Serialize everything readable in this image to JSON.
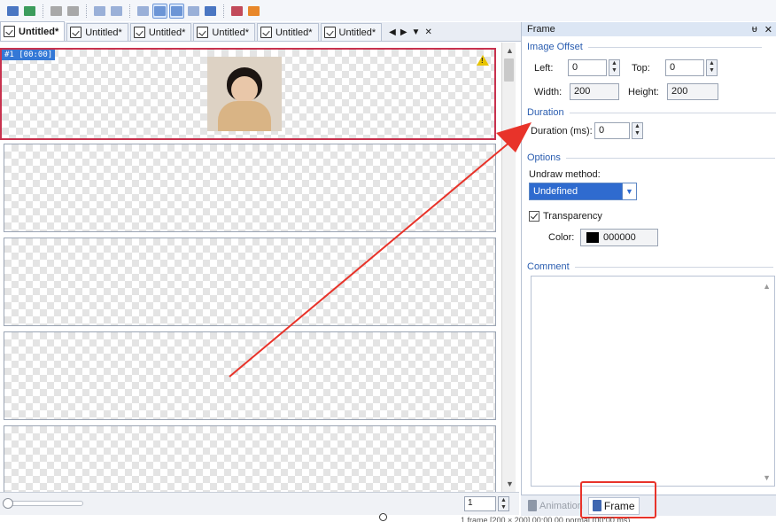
{
  "toolbar": {
    "buttons": [
      {
        "icon": "open-icon",
        "color": "#4a76c2"
      },
      {
        "icon": "save-icon",
        "color": "#3c9c5c"
      },
      {
        "icon": "copy-icon",
        "color": "#a8a8a8"
      },
      {
        "icon": "paste-icon",
        "color": "#a8a8a8"
      },
      {
        "icon": "flip-icon",
        "color": "#9ab0d8"
      },
      {
        "icon": "rotate-icon",
        "color": "#9ab0d8"
      },
      {
        "icon": "frame-view-icon",
        "color": "#9ab0d8"
      },
      {
        "icon": "thumbnail-view-icon",
        "color": "#6c95d6",
        "active": true
      },
      {
        "icon": "list-view-icon",
        "color": "#6c95d6",
        "active": true
      },
      {
        "icon": "grid-view-icon",
        "color": "#9ab0d8"
      },
      {
        "icon": "effects-icon",
        "color": "#4a76c2"
      },
      {
        "icon": "export-icon",
        "color": "#c24a5a"
      },
      {
        "icon": "rss-icon",
        "color": "#e8872a"
      }
    ]
  },
  "doc_tabs": {
    "tabs": [
      {
        "label": "Untitled*",
        "active": true
      },
      {
        "label": "Untitled*"
      },
      {
        "label": "Untitled*"
      },
      {
        "label": "Untitled*"
      },
      {
        "label": "Untitled*"
      },
      {
        "label": "Untitled*"
      }
    ],
    "nav": {
      "prev": "◀",
      "next": "▶",
      "menu": "▼",
      "close": "✕"
    }
  },
  "frames": {
    "first_label": "#1 [00:00]"
  },
  "bottom": {
    "page_value": "1",
    "status_text": "1 frame   [200 × 200]   00:00.00   normal   (00:00 ms)"
  },
  "panel": {
    "title": "Frame",
    "pin": "📌",
    "close": "✕",
    "image_offset": {
      "heading": "Image Offset",
      "left_label": "Left:",
      "left_value": "0",
      "top_label": "Top:",
      "top_value": "0",
      "width_label": "Width:",
      "width_value": "200",
      "height_label": "Height:",
      "height_value": "200"
    },
    "duration": {
      "heading": "Duration",
      "label": "Duration (ms):",
      "value": "0"
    },
    "options": {
      "heading": "Options",
      "undraw_label": "Undraw method:",
      "undraw_value": "Undefined",
      "transparency_label": "Transparency",
      "transparency_checked": true,
      "color_label": "Color:",
      "color_value": "000000"
    },
    "comment": {
      "heading": "Comment"
    }
  },
  "panel_tabs": [
    {
      "label": "Animation",
      "icon": "animation-icon"
    },
    {
      "label": "Frame",
      "icon": "frame-icon",
      "active": true
    }
  ],
  "annotation": {
    "color": "#e8332a"
  }
}
